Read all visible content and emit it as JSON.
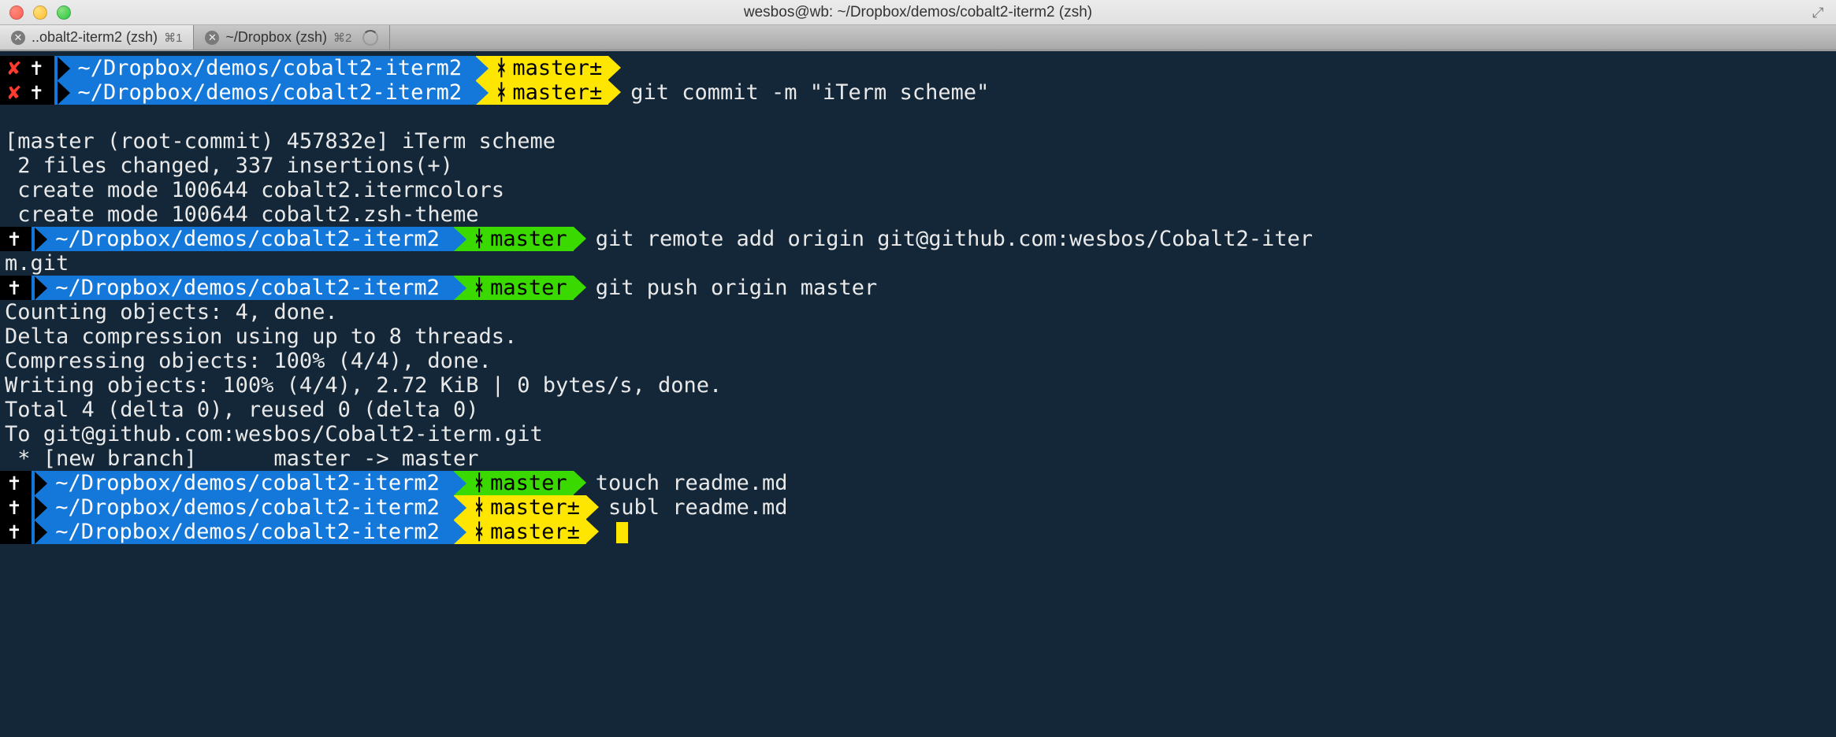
{
  "window": {
    "title": "wesbos@wb: ~/Dropbox/demos/cobalt2-iterm2 (zsh)"
  },
  "tabs": [
    {
      "label": "..obalt2-iterm2 (zsh)",
      "hotkey": "⌘1",
      "active": true
    },
    {
      "label": "~/Dropbox (zsh)",
      "hotkey": "⌘2",
      "active": false
    }
  ],
  "prompts": [
    {
      "status_glyphs": [
        "✘",
        "✝"
      ],
      "path": "~/Dropbox/demos/cobalt2-iterm2",
      "branch_seg": {
        "color": "yellow",
        "label": "master±"
      },
      "command": ""
    },
    {
      "status_glyphs": [
        "✘",
        "✝"
      ],
      "path": "~/Dropbox/demos/cobalt2-iterm2",
      "branch_seg": {
        "color": "yellow",
        "label": "master±"
      },
      "command": "git commit -m \"iTerm scheme\""
    },
    {
      "status_glyphs": [
        "✝"
      ],
      "path": "~/Dropbox/demos/cobalt2-iterm2",
      "branch_seg": {
        "color": "green",
        "label": "master"
      },
      "command": "git remote add origin git@github.com:wesbos/Cobalt2-iter"
    },
    {
      "status_glyphs": [
        "✝"
      ],
      "path": "~/Dropbox/demos/cobalt2-iterm2",
      "branch_seg": {
        "color": "green",
        "label": "master"
      },
      "command": "git push origin master"
    },
    {
      "status_glyphs": [
        "✝"
      ],
      "path": "~/Dropbox/demos/cobalt2-iterm2",
      "branch_seg": {
        "color": "green",
        "label": "master"
      },
      "command": "touch readme.md"
    },
    {
      "status_glyphs": [
        "✝"
      ],
      "path": "~/Dropbox/demos/cobalt2-iterm2",
      "branch_seg": {
        "color": "yellow",
        "label": "master±"
      },
      "command": "subl readme.md"
    },
    {
      "status_glyphs": [
        "✝"
      ],
      "path": "~/Dropbox/demos/cobalt2-iterm2",
      "branch_seg": {
        "color": "yellow",
        "label": "master±"
      },
      "command": ""
    }
  ],
  "output_block_1": [
    "",
    "[master (root-commit) 457832e] iTerm scheme",
    " 2 files changed, 337 insertions(+)",
    " create mode 100644 cobalt2.itermcolors",
    " create mode 100644 cobalt2.zsh-theme"
  ],
  "wrap_line": "m.git",
  "output_block_2": [
    "Counting objects: 4, done.",
    "Delta compression using up to 8 threads.",
    "Compressing objects: 100% (4/4), done.",
    "Writing objects: 100% (4/4), 2.72 KiB | 0 bytes/s, done.",
    "Total 4 (delta 0), reused 0 (delta 0)",
    "To git@github.com:wesbos/Cobalt2-iterm.git",
    " * [new branch]      master -> master"
  ],
  "branch_glyph": "ᚼ",
  "colors": {
    "bg": "#132738",
    "blue": "#1478db",
    "yellow": "#ffe600",
    "green": "#3ad900"
  }
}
